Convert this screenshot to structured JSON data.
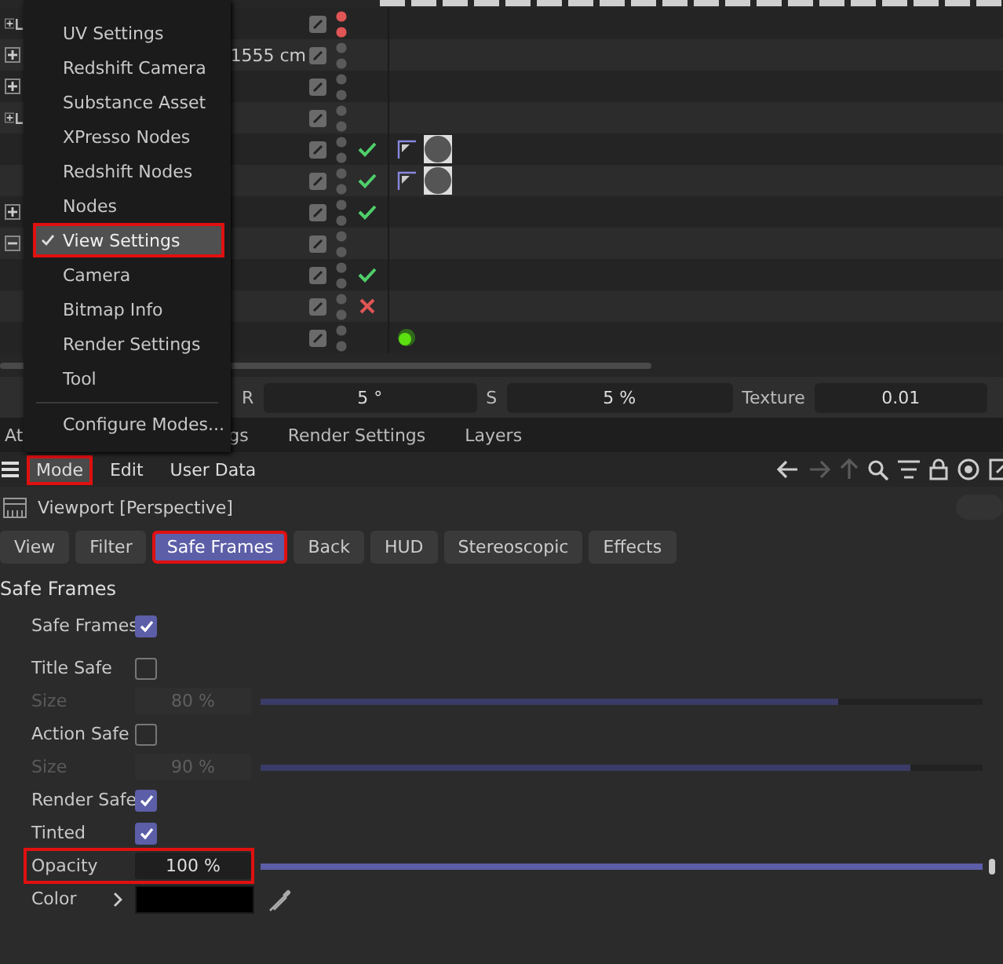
{
  "object_manager": {
    "rows": [
      {
        "expandable": true,
        "expanded": false,
        "layer": true,
        "color": "#e05555",
        "kind": "plain"
      },
      {
        "expandable": true,
        "expanded": false,
        "layer": false,
        "value": "1555 cm",
        "color": "#5a5a5a",
        "kind": "plain"
      },
      {
        "expandable": true,
        "expanded": false,
        "layer": false,
        "color": "#5a5a5a",
        "kind": "plain"
      },
      {
        "expandable": true,
        "expanded": false,
        "layer": true,
        "color": "#5a5a5a",
        "kind": "plain"
      },
      {
        "expandable": false,
        "layer": false,
        "color": "#5a5a5a",
        "kind": "check",
        "tags": [
          {
            "kind": "material"
          }
        ]
      },
      {
        "expandable": false,
        "layer": false,
        "color": "#5a5a5a",
        "kind": "check",
        "tags": [
          {
            "kind": "material"
          }
        ]
      },
      {
        "expandable": true,
        "expanded": false,
        "layer": false,
        "color": "#5a5a5a",
        "kind": "check"
      },
      {
        "expandable": true,
        "expanded": true,
        "layer": false,
        "color": "#5a5a5a",
        "kind": "plain"
      },
      {
        "expandable": false,
        "layer": false,
        "color": "#5a5a5a",
        "kind": "check"
      },
      {
        "expandable": false,
        "layer": false,
        "color": "#5a5a5a",
        "kind": "cross"
      },
      {
        "expandable": false,
        "layer": false,
        "color": "#5a5a5a",
        "kind": "plain",
        "tags": [
          {
            "kind": "light"
          }
        ]
      }
    ]
  },
  "mode_menu": {
    "items": [
      {
        "label": "UV Settings",
        "checked": false,
        "highlight": false
      },
      {
        "label": "Redshift Camera",
        "checked": false,
        "highlight": false
      },
      {
        "label": "Substance Asset",
        "checked": false,
        "highlight": false
      },
      {
        "label": "XPresso Nodes",
        "checked": false,
        "highlight": false
      },
      {
        "label": "Redshift Nodes",
        "checked": false,
        "highlight": false
      },
      {
        "label": "Nodes",
        "checked": false,
        "highlight": false
      },
      {
        "label": "View Settings",
        "checked": true,
        "highlight": true
      },
      {
        "label": "Camera",
        "checked": false,
        "highlight": false
      },
      {
        "label": "Bitmap Info",
        "checked": false,
        "highlight": false
      },
      {
        "label": "Render Settings",
        "checked": false,
        "highlight": false
      },
      {
        "label": "Tool",
        "checked": false,
        "highlight": false
      }
    ],
    "footer_item": "Configure Modes..."
  },
  "coordinates": [
    {
      "label": "R",
      "value": "5 °"
    },
    {
      "label": "S",
      "value": "5 %"
    },
    {
      "label": "Texture",
      "value": "0.01"
    }
  ],
  "manager_tabs": [
    {
      "label": "At"
    },
    {
      "label": "gs"
    },
    {
      "label": "Render Settings"
    },
    {
      "label": "Layers"
    }
  ],
  "menu_bar": [
    {
      "label": "Mode",
      "highlight": true
    },
    {
      "label": "Edit",
      "highlight": false
    },
    {
      "label": "User Data",
      "highlight": false
    }
  ],
  "object_title": "Viewport [Perspective]",
  "toggle": {
    "on": false
  },
  "tabs": [
    {
      "label": "View",
      "selected": false,
      "highlight": false
    },
    {
      "label": "Filter",
      "selected": false,
      "highlight": false
    },
    {
      "label": "Safe Frames",
      "selected": true,
      "highlight": true
    },
    {
      "label": "Back",
      "selected": false,
      "highlight": false
    },
    {
      "label": "HUD",
      "selected": false,
      "highlight": false
    },
    {
      "label": "Stereoscopic",
      "selected": false,
      "highlight": false
    },
    {
      "label": "Effects",
      "selected": false,
      "highlight": false
    }
  ],
  "section_title": "Safe Frames",
  "params": [
    {
      "kind": "checkbox",
      "label": "Safe Frames",
      "checked": true
    },
    {
      "kind": "checkbox",
      "label": "Title Safe",
      "checked": false
    },
    {
      "kind": "slider",
      "label": "Size",
      "value": "80 %",
      "level": 0.8,
      "disabled": true,
      "highlight": false
    },
    {
      "kind": "checkbox",
      "label": "Action Safe",
      "checked": false
    },
    {
      "kind": "slider",
      "label": "Size",
      "value": "90 %",
      "level": 0.9,
      "disabled": true,
      "highlight": false
    },
    {
      "kind": "checkbox",
      "label": "Render Safe",
      "checked": true
    },
    {
      "kind": "checkbox",
      "label": "Tinted",
      "checked": true
    },
    {
      "kind": "slider",
      "label": "Opacity",
      "value": "100 %",
      "level": 1,
      "disabled": false,
      "highlight": true
    },
    {
      "kind": "color",
      "label": "Color",
      "color": "#000000"
    }
  ]
}
